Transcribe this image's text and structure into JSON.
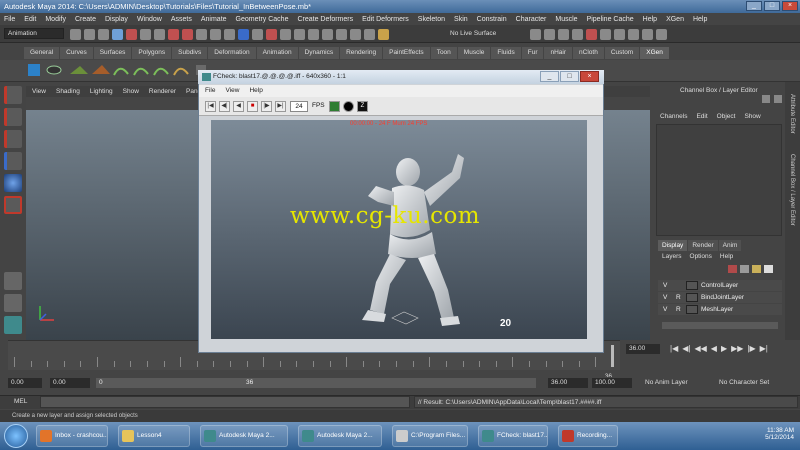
{
  "window": {
    "title": "Autodesk Maya 2014: C:\\Users\\ADMIN\\Desktop\\Tutorials\\Files\\Tutorial_InBetweenPose.mb*"
  },
  "menu": [
    "File",
    "Edit",
    "Modify",
    "Create",
    "Display",
    "Window",
    "Assets",
    "Animate",
    "Geometry Cache",
    "Create Deformers",
    "Edit Deformers",
    "Skeleton",
    "Skin",
    "Constrain",
    "Character",
    "Muscle",
    "Pipeline Cache",
    "Help",
    "XGen",
    "Help"
  ],
  "status": {
    "mode": "Animation",
    "no_live_surface": "No Live Surface"
  },
  "shelf_tabs": [
    "General",
    "Curves",
    "Surfaces",
    "Polygons",
    "Subdivs",
    "Deformation",
    "Animation",
    "Dynamics",
    "Rendering",
    "PaintEffects",
    "Toon",
    "Muscle",
    "Fluids",
    "Fur",
    "nHair",
    "nCloth",
    "Custom",
    "XGen"
  ],
  "viewport_menu": [
    "View",
    "Shading",
    "Lighting",
    "Show",
    "Renderer",
    "Panels"
  ],
  "fcheck": {
    "title": "FCheck: blast17.@.@.@.@.iff - 640x360 - 1:1",
    "menu": [
      "File",
      "View",
      "Help"
    ],
    "fps_value": "24",
    "fps_label": "FPS",
    "overlay": "00:00:00 - 24 F Mum 24 FPS",
    "frame_number": "20",
    "watermark": "www.cg-ku.com"
  },
  "channel_box": {
    "title": "Channel Box / Layer Editor",
    "menu": [
      "Channels",
      "Edit",
      "Object",
      "Show"
    ],
    "layer_tabs": [
      "Display",
      "Render",
      "Anim"
    ],
    "layer_menu": [
      "Layers",
      "Options",
      "Help"
    ],
    "layers": [
      {
        "v": "V",
        "r": "",
        "name": "ControlLayer"
      },
      {
        "v": "V",
        "r": "R",
        "name": "BindJointLayer"
      },
      {
        "v": "V",
        "r": "R",
        "name": "MeshLayer"
      }
    ],
    "side_tabs": [
      "Attribute Editor",
      "Channel Box / Layer Editor"
    ]
  },
  "timeline": {
    "current_frame": "36.00",
    "end_tick": "36"
  },
  "range": {
    "start": "0.00",
    "start2": "0.00",
    "inner_start": "0",
    "inner_end": "36",
    "end": "36.00",
    "end2": "100.00",
    "anim_layer": "No Anim Layer",
    "character_set": "No Character Set"
  },
  "mel": {
    "label": "MEL",
    "result": "// Result: C:\\Users\\ADMIN\\AppData\\Local\\Temp\\blast17.####.iff"
  },
  "helpline": "Create a new layer and assign selected objects",
  "taskbar": {
    "items": [
      {
        "label": "Inbox - crashcou...",
        "color": "#e2742a"
      },
      {
        "label": "Lesson4",
        "color": "#e6c45a"
      },
      {
        "label": "Autodesk Maya 2...",
        "color": "#3f8a8c"
      },
      {
        "label": "Autodesk Maya 2...",
        "color": "#3f8a8c"
      },
      {
        "label": "C:\\Program Files...",
        "color": "#cccccc"
      },
      {
        "label": "FCheck: blast17...",
        "color": "#3f8a8c"
      },
      {
        "label": "Recording...",
        "color": "#c0392b"
      }
    ],
    "time": "11:38 AM",
    "date": "5/12/2014"
  }
}
